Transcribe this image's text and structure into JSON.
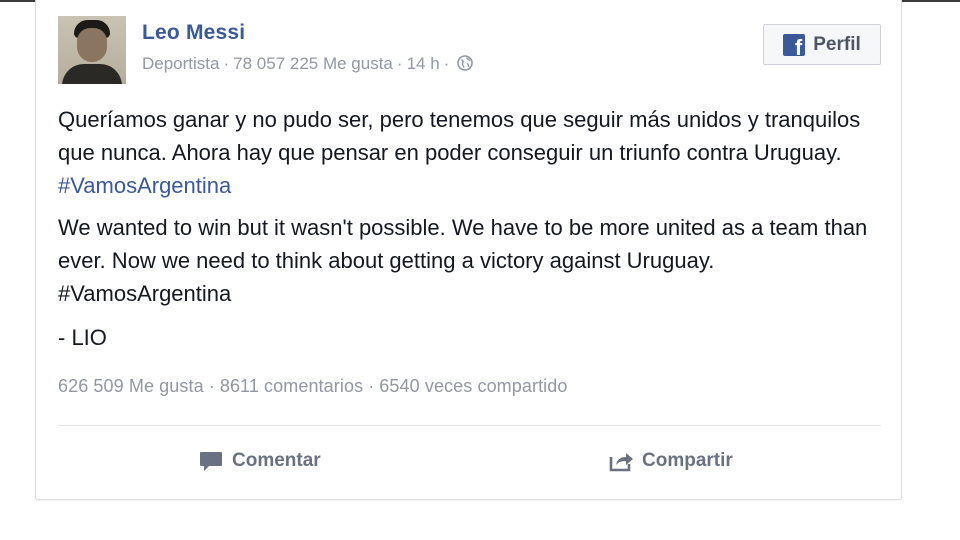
{
  "post": {
    "author": "Leo Messi",
    "meta": {
      "category": "Deportista",
      "likes_page": "78 057 225 Me gusta",
      "time": "14 h",
      "separator": "·"
    },
    "profile_button": {
      "label": "Perfil",
      "icon": "facebook-icon"
    },
    "text": {
      "es_line": "Queríamos ganar y no pudo ser, pero tenemos que seguir más unidos y tranquilos que nunca. Ahora hay que pensar en poder conseguir un triunfo contra Uruguay.",
      "es_hashtag": "#VamosArgentina",
      "en_line": "We wanted to win but it wasn't possible. We have to be more united as a team than ever. Now we need to think about getting a victory against Uruguay. #VamosArgentina",
      "signature": "- LIO"
    },
    "stats": {
      "likes": "626 509 Me gusta",
      "comments": "8611 comentarios",
      "shares": "6540 veces compartido",
      "separator": "·"
    },
    "actions": {
      "comment": {
        "label": "Comentar",
        "icon": "speech-bubble-icon"
      },
      "share": {
        "label": "Compartir",
        "icon": "share-arrow-icon"
      }
    }
  },
  "colors": {
    "link": "#3b5998",
    "meta": "#9197a3",
    "text": "#141823",
    "action": "#6a7180"
  }
}
